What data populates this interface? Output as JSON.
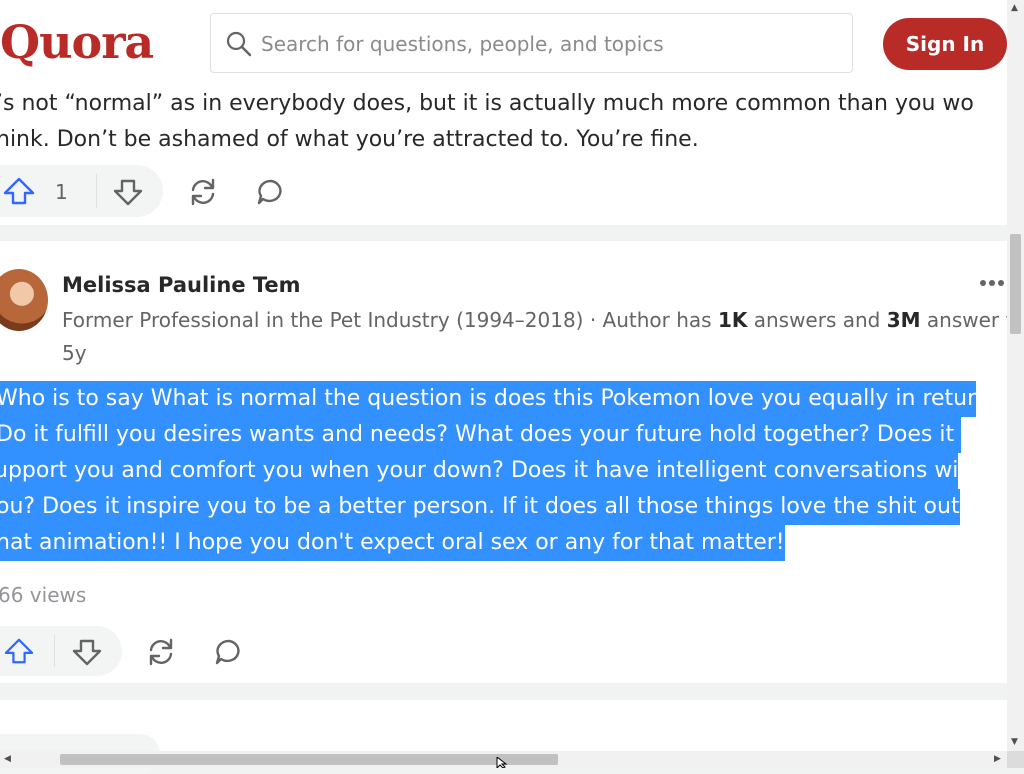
{
  "header": {
    "logo": "Quora",
    "search_placeholder": "Search for questions, people, and topics",
    "signin_label": "Sign In"
  },
  "answer1": {
    "text_lines": [
      "’s not “normal” as in everybody does, but it is actually much more common than you wo",
      "hink. Don’t be ashamed of what you’re attracted to. You’re fine."
    ],
    "upvote_count": "1"
  },
  "answer2": {
    "author_name": "Melissa Pauline Tem",
    "credential_prefix": "Former Professional in the Pet Industry (1994–2018) · Author has ",
    "answers_count": "1K",
    "credential_middle": " answers and ",
    "views_count": "3M",
    "credential_suffix": " answer vi",
    "time": "5y",
    "text_lines": [
      "Who is to say What is normal the question is does this Pokemon love you equally in retur",
      "Do it fulfill you desires wants and needs? What does your future hold together? Does it ",
      "upport you and comfort you when your down? Does it have intelligent conversations wi",
      "ou? Does it inspire you to be a better person. If it does all those things love the shit out",
      "hat animation!! I hope you don't expect oral sex or any for that matter!"
    ],
    "views": "66 views"
  },
  "colors": {
    "brand": "#b92b27",
    "selection": "#3390ff",
    "upvote_blue": "#2e69ff"
  },
  "icons": [
    "search-icon",
    "upvote-icon",
    "downvote-icon",
    "share-icon",
    "comment-icon",
    "more-icon"
  ]
}
